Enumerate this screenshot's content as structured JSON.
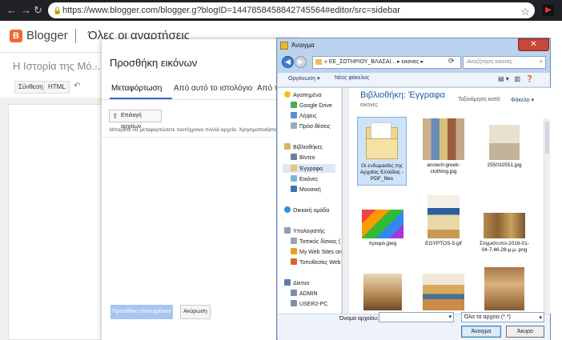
{
  "browser": {
    "url": "https://www.blogger.com/blogger.g?blogID=1447858458842745564#editor/src=sidebar"
  },
  "blogger": {
    "brand": "Blogger",
    "section": "Όλες οι αναρτήσεις",
    "post_title": "Η Ιστορία της Μό...",
    "post_title_dot": "·",
    "editor_tabs": [
      "Σύνθεση",
      "HTML"
    ]
  },
  "add_image": {
    "title": "Προσθήκη εικόνων",
    "tabs": [
      "Μεταφόρτωση",
      "Από αυτό το ιστολόγιο",
      "Από τ"
    ],
    "choose_files": "Επιλογή αρχείων",
    "hint": "Μπορείτε να μεταφορτώσετε ταυτόχρονα πολλά αρχεία. Χρησιμοποιήστε μόνο εικόνες",
    "add_selected": "Προσθήκη επιλεγμένων",
    "cancel": "Ακύρωση"
  },
  "open_dialog": {
    "title": "Άνοιγμα",
    "close": "✕",
    "path": "«  ΕΕ_ΣΩΤΗΡΙΟΥ_ΒΛΑΣΑΙ...  ▸  εικονες  ▸",
    "search_placeholder": "Αναζήτηση εικονες",
    "toolbar": {
      "organize": "Οργάνωση ▾",
      "new_folder": "Νέος φάκελος"
    },
    "library_title": "Βιβλιοθήκη: Έγγραφα",
    "library_sub": "εικονες",
    "sort_label": "Ταξινόμηση κατά:",
    "sort_value": "Φάκελο ▾",
    "nav": {
      "favorites_header": "Αγαπημένα",
      "favorites": [
        "Google Drive",
        "Λήψεις",
        "Πρόσ.θέσεις"
      ],
      "libraries_header": "Βιβλιοθήκες",
      "libraries": [
        "Βίντεο",
        "Έγγραφα",
        "Εικόνες",
        "Μουσική"
      ],
      "homegroup": "Οικιακή ομάδα",
      "computer_header": "Υπολογιστής",
      "computer": [
        "Τοπικός δίσκος (",
        "My Web Sites on",
        "Τοποθεσίες Web"
      ],
      "network_header": "Δίκτυο",
      "network": [
        "ADMIN",
        "USER2-PC"
      ]
    },
    "files": [
      {
        "name": "Οι ενδυμασίες της Αρχαίας Ελλάδας - PDF_files",
        "icon": "folder-icon"
      },
      {
        "name": "ancient-greek-clothing.jpg",
        "icon": "image-thumbnail"
      },
      {
        "name": "255032551.jpg",
        "icon": "image-thumbnail"
      },
      {
        "name": "προφιλ.jpeg",
        "icon": "image-thumbnail"
      },
      {
        "name": "EGYPTOS-5.gif",
        "icon": "image-thumbnail"
      },
      {
        "name": "Στιγμιότυπο-2016-01-04-7.46.28-μ.μ..png",
        "icon": "image-thumbnail"
      },
      {
        "name": "",
        "icon": "image-thumbnail"
      },
      {
        "name": "",
        "icon": "image-thumbnail"
      },
      {
        "name": "",
        "icon": "image-thumbnail"
      }
    ],
    "filename_label": "Όνομα αρχείου:",
    "filename_value": "",
    "filetype": "Όλα τα αρχεία (*.*)",
    "open_button": "Άνοιγμα",
    "cancel_button": "Άκυρο"
  }
}
